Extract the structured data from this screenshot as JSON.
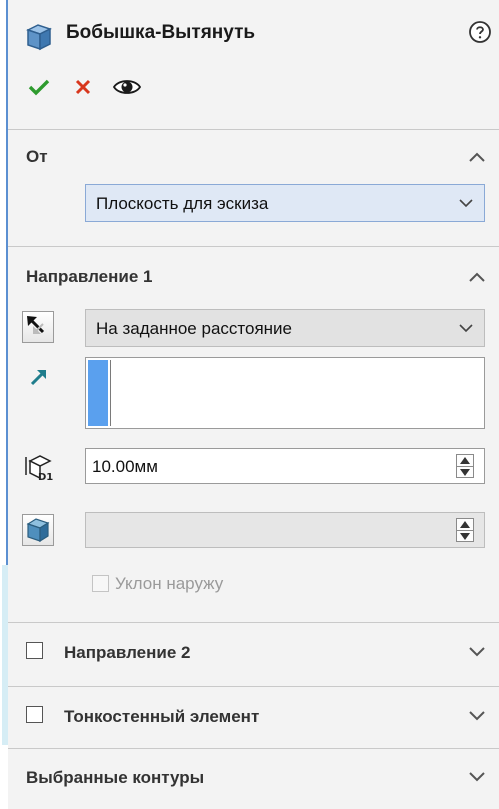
{
  "header": {
    "title": "Бобышка-Вытянуть",
    "icon": "extrude-boss-icon",
    "help_icon": "help-icon"
  },
  "actions": [
    {
      "name": "ok",
      "icon": "checkmark-icon",
      "color": "#2e9b2e"
    },
    {
      "name": "cancel",
      "icon": "close-icon",
      "color": "#d8361c"
    },
    {
      "name": "preview",
      "icon": "eye-icon",
      "color": "#1a1a1a"
    }
  ],
  "from_section": {
    "title": "От",
    "start_condition": "Плоскость для эскиза"
  },
  "direction1_section": {
    "title": "Направление 1",
    "end_condition": "На заданное расстояние",
    "depth_value": "10.00мм",
    "draft_outward_label": "Уклон наружу",
    "selection_color": "#5aa0ee"
  },
  "direction2_section": {
    "title": "Направление 2",
    "checked": false
  },
  "thin_feature_section": {
    "title": "Тонкостенный элемент",
    "checked": false
  },
  "selected_contours_section": {
    "title": "Выбранные контуры"
  },
  "colors": {
    "panel_bg": "#f3f3f3",
    "accent_blue": "#5b8fd1",
    "field_highlight": "#dfe8f5"
  }
}
